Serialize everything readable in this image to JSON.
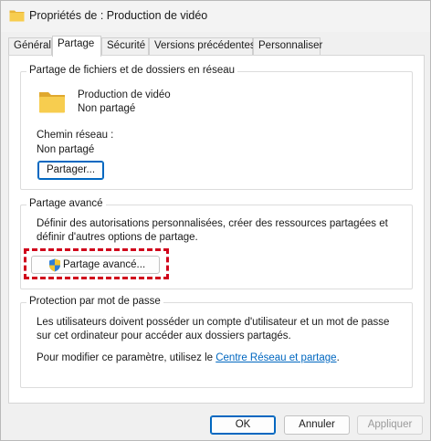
{
  "window": {
    "title": "Propriétés de : Production de vidéo"
  },
  "tabs": [
    {
      "label": "Général",
      "active": false
    },
    {
      "label": "Partage",
      "active": true
    },
    {
      "label": "Sécurité",
      "active": false
    },
    {
      "label": "Versions précédentes",
      "active": false
    },
    {
      "label": "Personnaliser",
      "active": false
    }
  ],
  "network_sharing": {
    "title": "Partage de fichiers et de dossiers en réseau",
    "folder_name": "Production de vidéo",
    "folder_status": "Non partagé",
    "network_path_label": "Chemin réseau :",
    "network_path_value": "Non partagé",
    "share_button": "Partager..."
  },
  "advanced_sharing": {
    "title": "Partage avancé",
    "description": "Définir des autorisations personnalisées, créer des ressources partagées et définir d'autres options de partage.",
    "button": "Partage avancé..."
  },
  "password_protection": {
    "title": "Protection par mot de passe",
    "description": "Les utilisateurs doivent posséder un compte d'utilisateur et un mot de passe sur cet ordinateur pour accéder aux dossiers partagés.",
    "change_prefix": "Pour modifier ce paramètre, utilisez le ",
    "link": "Centre Réseau et partage",
    "change_suffix": "."
  },
  "footer": {
    "ok": "OK",
    "cancel": "Annuler",
    "apply": "Appliquer"
  },
  "icons": {
    "folder": "folder-icon",
    "shield": "uac-shield-icon"
  },
  "colors": {
    "folder": "#f4c542",
    "highlight": "#d0001b",
    "link": "#0067c0",
    "accent": "#0067c0"
  }
}
